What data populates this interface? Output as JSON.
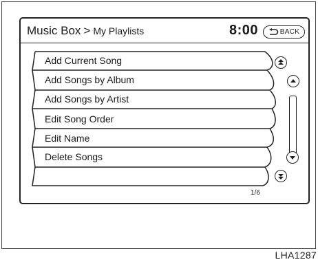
{
  "header": {
    "breadcrumb_main": "Music Box",
    "breadcrumb_separator": ">",
    "breadcrumb_sub": "My Playlists",
    "clock": "8:00",
    "back_label": "BACK"
  },
  "menu": {
    "items": [
      {
        "label": "Add Current Song"
      },
      {
        "label": "Add Songs by Album"
      },
      {
        "label": "Add Songs by Artist"
      },
      {
        "label": "Edit Song Order"
      },
      {
        "label": "Edit Name"
      },
      {
        "label": "Delete Songs"
      }
    ]
  },
  "scroll": {
    "buttons": [
      "page-up-icon",
      "scroll-up-icon",
      "scroll-down-icon",
      "page-down-icon"
    ]
  },
  "page_indicator": "1/6",
  "figure_code": "LHA1287",
  "colors": {
    "line": "#222222",
    "background": "#ffffff"
  }
}
